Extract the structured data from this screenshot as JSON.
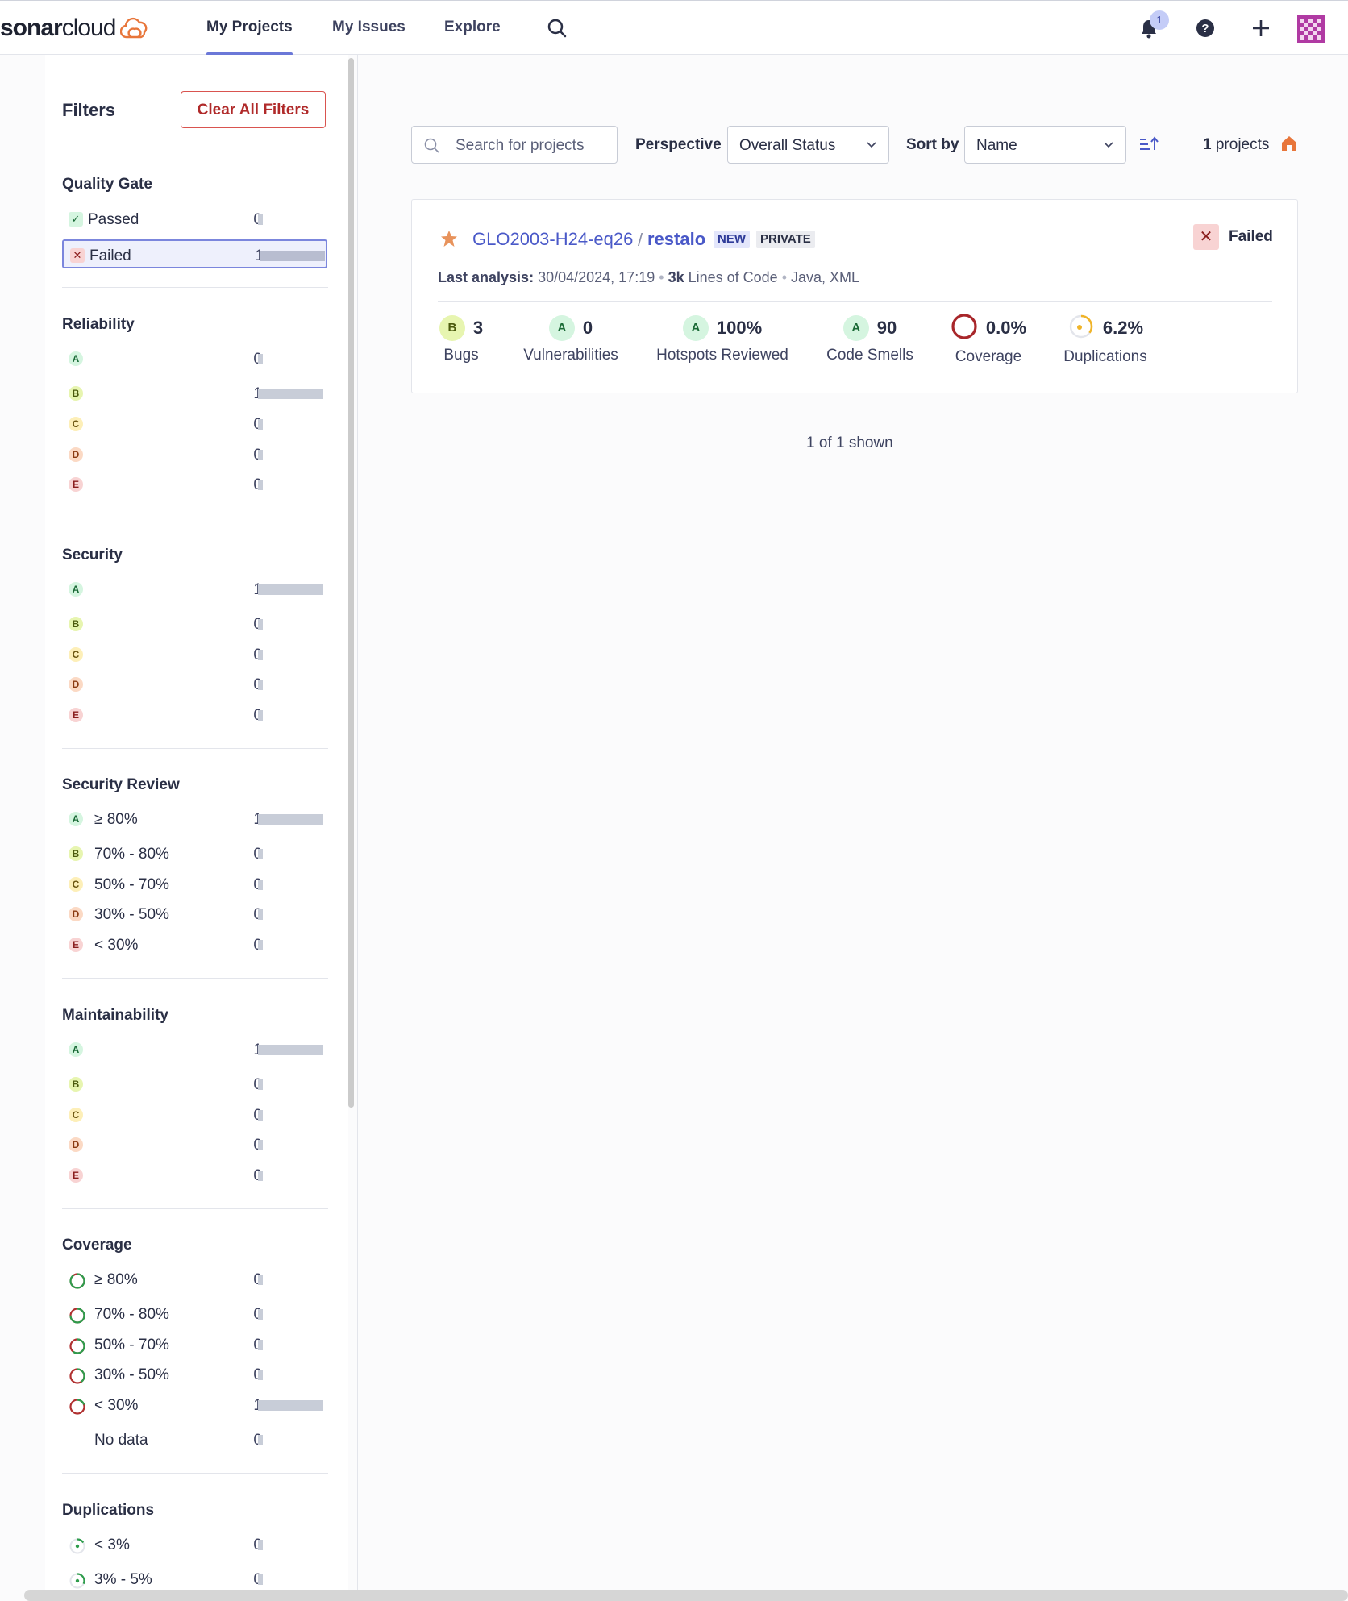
{
  "nav": {
    "logo_bold": "sonar",
    "logo_rest": "cloud",
    "items": [
      {
        "label": "My Projects"
      },
      {
        "label": "My Issues"
      },
      {
        "label": "Explore"
      }
    ],
    "notification_count": "1",
    "icons": [
      "search-icon",
      "bell-icon",
      "help-icon",
      "plus-icon",
      "avatar"
    ]
  },
  "filters": {
    "title": "Filters",
    "clear_label": "Clear All Filters",
    "quality_gate": {
      "title": "Quality Gate",
      "items": [
        {
          "label": "Passed",
          "count": "0",
          "share": 0,
          "selected": false
        },
        {
          "label": "Failed",
          "count": "1",
          "share": 1,
          "selected": true
        }
      ]
    },
    "reliability": {
      "title": "Reliability",
      "items": [
        {
          "rating": "A",
          "label": "",
          "count": "0",
          "share": 0
        },
        {
          "rating": "B",
          "label": "",
          "count": "1",
          "share": 1
        },
        {
          "rating": "C",
          "label": "",
          "count": "0",
          "share": 0
        },
        {
          "rating": "D",
          "label": "",
          "count": "0",
          "share": 0
        },
        {
          "rating": "E",
          "label": "",
          "count": "0",
          "share": 0
        }
      ]
    },
    "security": {
      "title": "Security",
      "items": [
        {
          "rating": "A",
          "label": "",
          "count": "1",
          "share": 1
        },
        {
          "rating": "B",
          "label": "",
          "count": "0",
          "share": 0
        },
        {
          "rating": "C",
          "label": "",
          "count": "0",
          "share": 0
        },
        {
          "rating": "D",
          "label": "",
          "count": "0",
          "share": 0
        },
        {
          "rating": "E",
          "label": "",
          "count": "0",
          "share": 0
        }
      ]
    },
    "security_review": {
      "title": "Security Review",
      "items": [
        {
          "rating": "A",
          "label": "≥ 80%",
          "count": "1",
          "share": 1
        },
        {
          "rating": "B",
          "label": "70% - 80%",
          "count": "0",
          "share": 0
        },
        {
          "rating": "C",
          "label": "50% - 70%",
          "count": "0",
          "share": 0
        },
        {
          "rating": "D",
          "label": "30% - 50%",
          "count": "0",
          "share": 0
        },
        {
          "rating": "E",
          "label": "< 30%",
          "count": "0",
          "share": 0
        }
      ]
    },
    "maintainability": {
      "title": "Maintainability",
      "items": [
        {
          "rating": "A",
          "label": "",
          "count": "1",
          "share": 1
        },
        {
          "rating": "B",
          "label": "",
          "count": "0",
          "share": 0
        },
        {
          "rating": "C",
          "label": "",
          "count": "0",
          "share": 0
        },
        {
          "rating": "D",
          "label": "",
          "count": "0",
          "share": 0
        },
        {
          "rating": "E",
          "label": "",
          "count": "0",
          "share": 0
        }
      ]
    },
    "coverage": {
      "title": "Coverage",
      "items": [
        {
          "label": "≥ 80%",
          "count": "0",
          "share": 0,
          "fill": 0.9
        },
        {
          "label": "70% - 80%",
          "count": "0",
          "share": 0,
          "fill": 0.75
        },
        {
          "label": "50% - 70%",
          "count": "0",
          "share": 0,
          "fill": 0.6
        },
        {
          "label": "30% - 50%",
          "count": "0",
          "share": 0,
          "fill": 0.4
        },
        {
          "label": "< 30%",
          "count": "1",
          "share": 1,
          "fill": 0.2
        },
        {
          "label": "No data",
          "count": "0",
          "share": 0,
          "fill": null
        }
      ]
    },
    "duplications": {
      "title": "Duplications",
      "items": [
        {
          "label": "< 3%",
          "count": "0",
          "share": 0,
          "fill": 0.02
        },
        {
          "label": "3% - 5%",
          "count": "0",
          "share": 0,
          "fill": 0.04
        }
      ]
    }
  },
  "toolbar": {
    "search_placeholder": "Search for projects",
    "perspective_label": "Perspective",
    "perspective_value": "Overall Status",
    "sort_label": "Sort by",
    "sort_value": "Name",
    "count_number": "1",
    "count_text": "projects"
  },
  "project": {
    "org": "GLO2003-H24-eq26",
    "separator": "/",
    "name": "restalo",
    "tags": [
      "NEW",
      "PRIVATE"
    ],
    "quality_gate": "Failed",
    "analysis_label": "Last analysis:",
    "analysis_date": "30/04/2024, 17:19",
    "loc_value": "3k",
    "loc_label": "Lines of Code",
    "languages": "Java, XML",
    "metrics": [
      {
        "rating": "B",
        "value": "3",
        "label": "Bugs"
      },
      {
        "rating": "A",
        "value": "0",
        "label": "Vulnerabilities"
      },
      {
        "rating": "A",
        "value": "100%",
        "label": "Hotspots Reviewed"
      },
      {
        "rating": "A",
        "value": "90",
        "label": "Code Smells"
      },
      {
        "rating": null,
        "value": "0.0%",
        "label": "Coverage",
        "fill": 0.0
      },
      {
        "rating": null,
        "value": "6.2%",
        "label": "Duplications",
        "fill": 0.062
      }
    ]
  },
  "footer": {
    "shown_text": "1 of 1 shown"
  },
  "colors": {
    "accent": "#6b78d8",
    "link": "#4a59c8",
    "failed": "#d02f3a",
    "bar": "#c8cdd8"
  }
}
